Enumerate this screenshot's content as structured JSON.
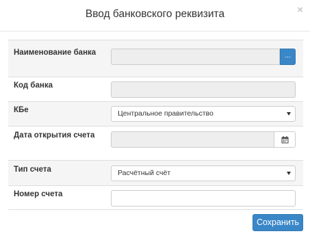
{
  "dialog": {
    "title": "Ввод банковского реквизита",
    "close_glyph": "×"
  },
  "form": {
    "bank_name": {
      "label": "Наименование банка",
      "value": "",
      "button_label": "..."
    },
    "bank_code": {
      "label": "Код банка",
      "value": ""
    },
    "kbe": {
      "label": "КБе",
      "selected": "Центральное правительство"
    },
    "open_date": {
      "label": "Дата открытия счета",
      "value": ""
    },
    "account_type": {
      "label": "Тип счета",
      "selected": "Расчётный счёт"
    },
    "account_number": {
      "label": "Номер счета",
      "value": ""
    }
  },
  "footer": {
    "save_label": "Сохранить"
  },
  "colors": {
    "primary": "#3a87c8",
    "row_shade": "#f5f5f5",
    "disabled_bg": "#eeeeee"
  },
  "icons": {
    "date_picker": "calendar-icon",
    "dropdown": "caret-down-icon"
  }
}
